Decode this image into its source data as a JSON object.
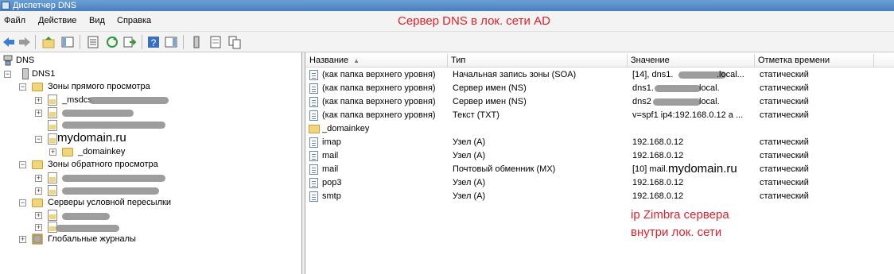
{
  "window": {
    "title": "Диспетчер DNS"
  },
  "menu": [
    "Файл",
    "Действие",
    "Вид",
    "Справка"
  ],
  "annotations": {
    "top": "Сервер DNS в лок. сети AD",
    "ip_line1": "ip Zimbra сервера",
    "ip_line2": "внутри лок. сети"
  },
  "tree": {
    "root": "DNS",
    "server": "DNS1",
    "forward_zones": "Зоны прямого просмотра",
    "msdcs_prefix": "_msdcs.",
    "mydomain": "mydomain.ru",
    "domainkey": "_domainkey",
    "reverse_zones": "Зоны обратного просмотра",
    "conditional_forwarders": "Серверы условной пересылки",
    "global_logs": "Глобальные журналы"
  },
  "columns": {
    "name": "Название",
    "type": "Тип",
    "value": "Значение",
    "timestamp": "Отметка времени"
  },
  "records": [
    {
      "name": "(как папка верхнего уровня)",
      "type": "Начальная запись зоны (SOA)",
      "value_pre": "[14], dns1.",
      "value_post": ".local...",
      "timestamp": "статический",
      "icon": "record-icon"
    },
    {
      "name": "(как папка верхнего уровня)",
      "type": "Сервер имен (NS)",
      "value_pre": "dns1.",
      "value_post": "local.",
      "timestamp": "статический",
      "icon": "record-icon"
    },
    {
      "name": "(как папка верхнего уровня)",
      "type": "Сервер имен (NS)",
      "value_pre": "dns2",
      "value_post": "local.",
      "timestamp": "статический",
      "icon": "record-icon"
    },
    {
      "name": "(как папка верхнего уровня)",
      "type": "Текст (TXT)",
      "value_pre": "v=spf1 ip4:192.168.0.12 a ...",
      "value_post": "",
      "timestamp": "статический",
      "icon": "record-icon"
    },
    {
      "name": "_domainkey",
      "type": "",
      "value_pre": "",
      "value_post": "",
      "timestamp": "",
      "icon": "folder-icon"
    },
    {
      "name": "imap",
      "type": "Узел (A)",
      "value_pre": "192.168.0.12",
      "value_post": "",
      "timestamp": "статический",
      "icon": "record-icon"
    },
    {
      "name": "mail",
      "type": "Узел (A)",
      "value_pre": "192.168.0.12",
      "value_post": "",
      "timestamp": "статический",
      "icon": "record-icon"
    },
    {
      "name": "mail",
      "type": "Почтовый обменник (MX)",
      "value_pre": "[10]  mail.",
      "value_post": "",
      "timestamp": "статический",
      "icon": "record-icon",
      "value_overlay": "mydomain.ru"
    },
    {
      "name": "pop3",
      "type": "Узел (A)",
      "value_pre": "192.168.0.12",
      "value_post": "",
      "timestamp": "статический",
      "icon": "record-icon"
    },
    {
      "name": "smtp",
      "type": "Узел (A)",
      "value_pre": "192.168.0.12",
      "value_post": "",
      "timestamp": "статический",
      "icon": "record-icon"
    }
  ]
}
